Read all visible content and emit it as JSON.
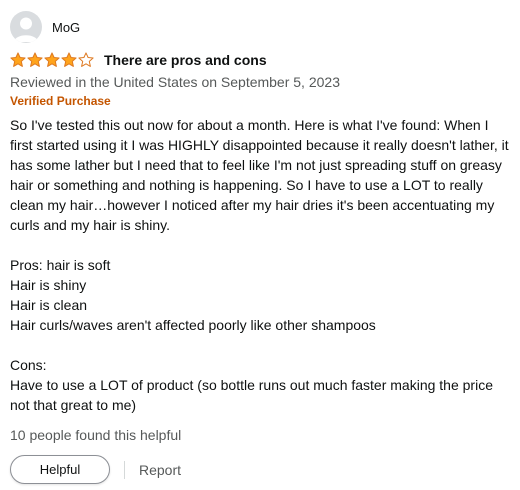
{
  "reviewer": {
    "name": "MoG"
  },
  "review": {
    "rating": 4,
    "rating_max": 5,
    "star_color": "#ffa41c",
    "title": "There are pros and cons",
    "date_line": "Reviewed in the United States on September 5, 2023",
    "verified_label": "Verified Purchase",
    "verified_color": "#c45500",
    "body_paragraphs": [
      "So I've tested this out now for about a month. Here is what I've found: When I first started using it I was HIGHLY disappointed because it really doesn't lather, it has some lather but I need that to feel like I'm not just spreading stuff on greasy hair or something and nothing is happening. So I have to use a LOT to really clean my hair…however I noticed after my hair dries it's been accentuating my curls and my hair is shiny.",
      "Pros: hair is soft\nHair is shiny\nHair is clean\nHair curls/waves aren't affected poorly like other shampoos",
      "Cons:\nHave to use a LOT of product (so bottle runs out much faster making the price not that great to me)"
    ],
    "helpful_count_text": "10 people found this helpful"
  },
  "actions": {
    "helpful_label": "Helpful",
    "report_label": "Report"
  }
}
